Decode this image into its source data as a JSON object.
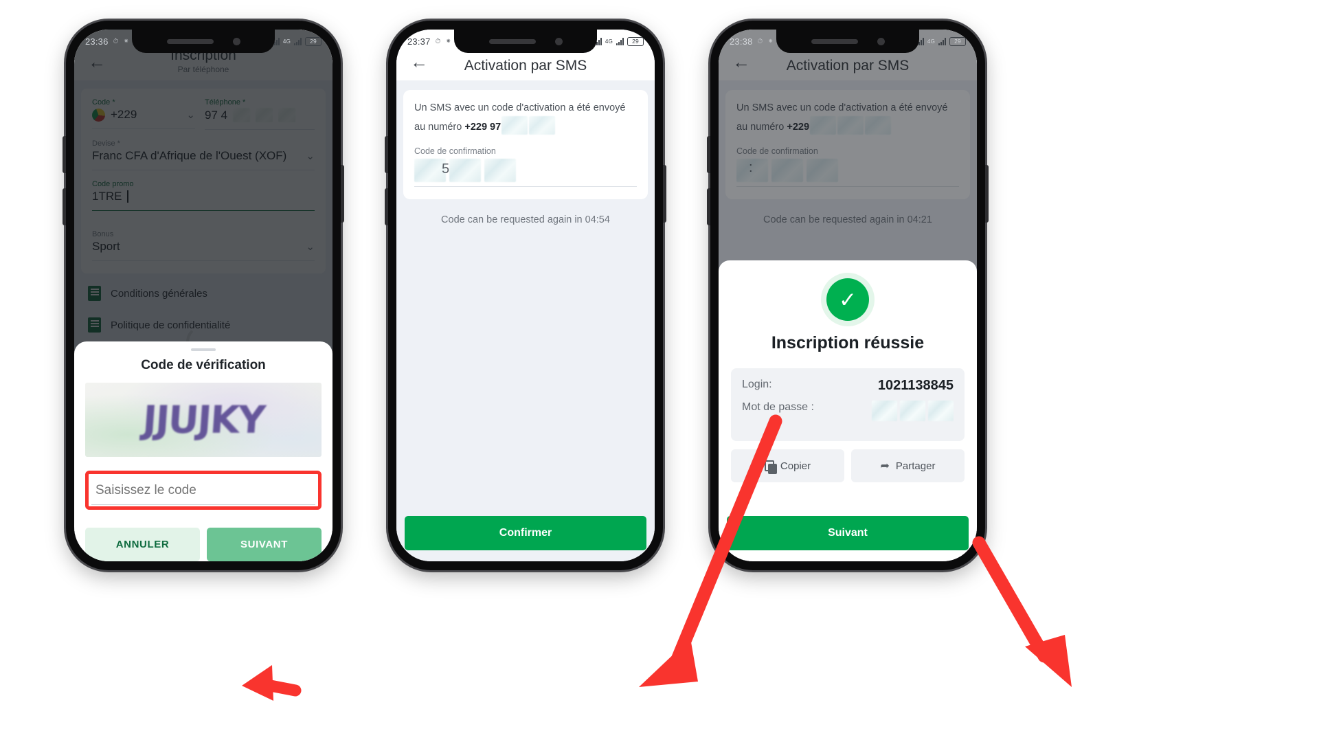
{
  "panels": [
    {
      "id": "registration",
      "status": {
        "time": "23:36",
        "icons": [
          "alarm-icon",
          "vibrate-icon"
        ],
        "network_label": "4G",
        "battery": "29"
      },
      "appbar": {
        "title": "Inscription",
        "subtitle": "Par téléphone",
        "back": "back-arrow"
      },
      "form": {
        "code_label": "Code *",
        "code_value": "+229",
        "phone_label": "Téléphone *",
        "phone_value": "97 4",
        "currency_label": "Devise *",
        "currency_value": "Franc CFA d'Afrique de l'Ouest (XOF)",
        "promo_label": "Code promo",
        "promo_value": "1TRE",
        "bonus_label": "Bonus",
        "bonus_value": "Sport",
        "terms": "Conditions générales",
        "terms2": "Politique de confidentialité"
      },
      "sheet": {
        "title": "Code de vérification",
        "captcha_text": "JJUJKY",
        "input_placeholder": "Saisissez le code",
        "input_value": "",
        "cancel_label": "ANNULER",
        "next_label": "SUIVANT"
      }
    },
    {
      "id": "sms-activation",
      "status": {
        "time": "23:37",
        "icons": [
          "alarm-icon",
          "vibrate-icon"
        ],
        "network_label": "4G",
        "battery": "29"
      },
      "appbar": {
        "title": "Activation par SMS",
        "back": "back-arrow"
      },
      "sms": {
        "line1": "Un SMS avec un code d'activation a été envoyé",
        "line2_prefix": "au numéro ",
        "phone": "+229 97",
        "confirmation_label": "Code de confirmation",
        "confirmation_value": "5"
      },
      "timer_text": "Code can be requested again in 04:54",
      "cta_label": "Confirmer"
    },
    {
      "id": "success",
      "status": {
        "time": "23:38",
        "icons": [
          "alarm-icon",
          "vibrate-icon"
        ],
        "network_label": "4G",
        "battery": "29"
      },
      "appbar": {
        "title": "Activation par SMS",
        "back": "back-arrow"
      },
      "sms": {
        "line1": "Un SMS avec un code d'activation a été envoyé",
        "line2_prefix": "au numéro ",
        "phone": "+229",
        "confirmation_label": "Code de confirmation",
        "confirmation_value": ":"
      },
      "timer_text": "Code can be requested again in 04:21",
      "success": {
        "icon": "check-circle-icon",
        "title": "Inscription réussie",
        "login_label": "Login:",
        "login_value": "1021138845",
        "password_label": "Mot de passe :",
        "copy_label": "Copier",
        "share_label": "Partager",
        "cta_label": "Suivant"
      }
    }
  ],
  "colors": {
    "brand_green": "#00a650",
    "dark_green": "#0f6b3f",
    "arrow_red": "#f9342e",
    "app_bg": "#eef1f6"
  }
}
